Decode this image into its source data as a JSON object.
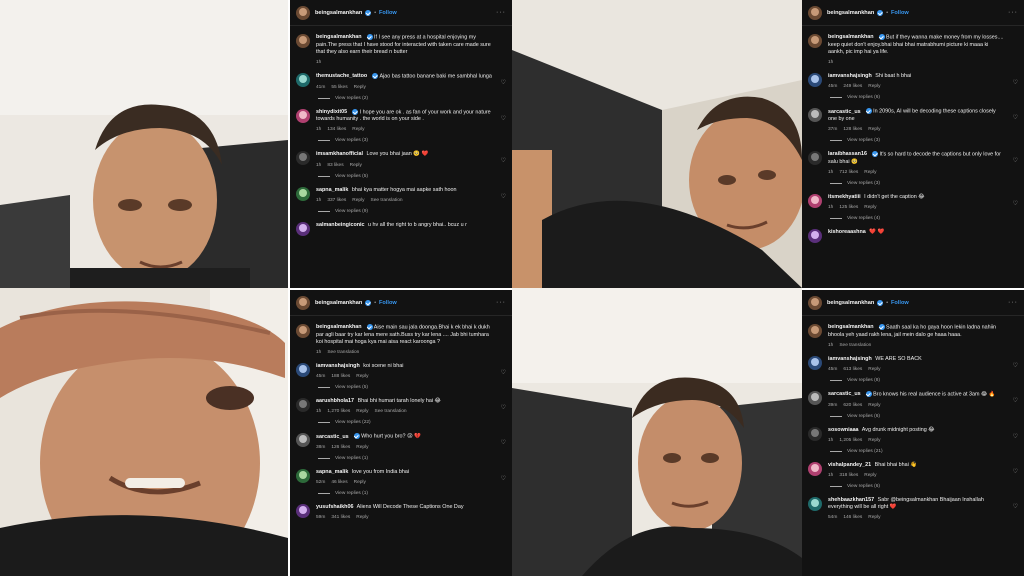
{
  "panel1": {
    "username": "beingsalmankhan",
    "follow": "Follow",
    "caption": {
      "user": "beingsalmankhan",
      "text": "If I see any press at a hospital enjoying my pain.The press that I have stood for interacted with taken care made sure that they also earn their bread n butter",
      "time": "1h"
    },
    "comments": [
      {
        "user": "themustache_tattoo",
        "text": "Ajao bas tattoo banane baki me sambhal lunga",
        "time": "41m",
        "likes": "55 likes",
        "reply": "Reply",
        "replies": "View replies (2)"
      },
      {
        "user": "shinydixit05",
        "text": "I hope you are ok . as fan of your work and your nature towards humanity . the world is on your side .",
        "time": "1h",
        "likes": "134 likes",
        "reply": "Reply",
        "replies": "View replies (3)"
      },
      {
        "user": "imsamkhanofficial",
        "text": "Love you bhai jaan 🥺 ❤️",
        "time": "1h",
        "likes": "83 likes",
        "reply": "Reply",
        "replies": "View replies (5)"
      },
      {
        "user": "sapna_malik",
        "text": "bhai kya matter hogya mai aapke sath hoon",
        "time": "1h",
        "likes": "337 likes",
        "reply": "Reply",
        "extra": "See translation",
        "replies": "View replies (9)"
      },
      {
        "user": "salmanbeingiconic",
        "text": "u hv all the right to b angry bhai.. bcuz u r",
        "time": "",
        "likes": "",
        "reply": "",
        "replies": ""
      }
    ]
  },
  "panel2": {
    "username": "beingsalmankhan",
    "follow": "Follow",
    "caption": {
      "user": "beingsalmankhan",
      "text": "But if they wanna make money from my losses.... keep quiet don't enjoy.bhai bhai bhai matrabhumi picture ki maaa ki aankh, pic imp hai ya life.",
      "time": "1h"
    },
    "comments": [
      {
        "user": "iamvanshajsingh",
        "text": "Shi baat h bhai",
        "time": "45m",
        "likes": "249 likes",
        "reply": "Reply",
        "replies": "View replies (6)"
      },
      {
        "user": "sarcastic_us",
        "text": "In 2090s, AI will be decoding these captions closely one by one",
        "time": "37m",
        "likes": "128 likes",
        "reply": "Reply",
        "replies": "View replies (3)"
      },
      {
        "user": "laraibhassan16",
        "text": "It's so hard to decode the captions but only love for salu bhai 🥺",
        "time": "1h",
        "likes": "712 likes",
        "reply": "Reply",
        "replies": "View replies (3)"
      },
      {
        "user": "itsmekhyatiii",
        "text": "I didn't get the caption 😂",
        "time": "1h",
        "likes": "125 likes",
        "reply": "Reply",
        "replies": "View replies (4)"
      },
      {
        "user": "kishoreaashna",
        "text": "❤️ ❤️",
        "time": "",
        "likes": "",
        "reply": "",
        "replies": ""
      }
    ]
  },
  "panel3": {
    "username": "beingsalmankhan",
    "follow": "Follow",
    "caption": {
      "user": "beingsalmankhan",
      "text": "Aise main sau jala doonga.Bhai k ek bhai k dukh par agli baar try kar lena mere sath.Buss try kar lena .... Jab bhi tumhara koi hospital mai hoga kya mai aisa react karoonga ?",
      "time": "1h",
      "extra": "See translation"
    },
    "comments": [
      {
        "user": "iamvanshajsingh",
        "text": "koi scene ni bhai",
        "time": "45m",
        "likes": "188 likes",
        "reply": "Reply",
        "replies": "View replies (5)"
      },
      {
        "user": "aarushbhola17",
        "text": "Bhai bhi humari tarah lonely hai 😂",
        "time": "1h",
        "likes": "1,270 likes",
        "reply": "Reply",
        "extra": "See translation",
        "replies": "View replies (22)"
      },
      {
        "user": "sarcastic_us",
        "text": "Who hurt you bro? 😢 💔",
        "time": "38m",
        "likes": "126 likes",
        "reply": "Reply",
        "replies": "View replies (1)"
      },
      {
        "user": "sapna_malik",
        "text": "love you from India bhai",
        "time": "52m",
        "likes": "46 likes",
        "reply": "Reply",
        "replies": "View replies (1)"
      },
      {
        "user": "yusufshaikh06",
        "text": "Aliens Will Decode These Captions One Day",
        "time": "59m",
        "likes": "341 likes",
        "reply": "Reply",
        "replies": ""
      }
    ]
  },
  "panel4": {
    "username": "beingsalmankhan",
    "follow": "Follow",
    "caption": {
      "user": "beingsalmankhan",
      "text": "Saath saal ka ho gaya hoon lekin ladna nahiin bhoola yeh yaad rakh lena, jail mein dalo ge haaa haaa.",
      "time": "1h",
      "extra": "See translation"
    },
    "comments": [
      {
        "user": "iamvanshajsingh",
        "text": "WE ARE SO BACK",
        "time": "45m",
        "likes": "613 likes",
        "reply": "Reply",
        "replies": "View replies (8)"
      },
      {
        "user": "sarcastic_us",
        "text": "Bro knows his real audience is active at 3am 😂 🔥",
        "time": "39m",
        "likes": "620 likes",
        "reply": "Reply",
        "replies": "View replies (6)"
      },
      {
        "user": "sosowniaaa",
        "text": "Avg drunk midnight posting 😂",
        "time": "1h",
        "likes": "1,205 likes",
        "reply": "Reply",
        "replies": "View replies (21)"
      },
      {
        "user": "vishalpandey_21",
        "text": "Bhai bhai bhai 👋",
        "time": "1h",
        "likes": "318 likes",
        "reply": "Reply",
        "replies": "View replies (6)"
      },
      {
        "user": "shehbaazkhan157",
        "text": "Sabr @beingsalmankhan Bhaijaan Inshallah everything will be all right ❤️",
        "time": "54m",
        "likes": "146 likes",
        "reply": "Reply",
        "replies": ""
      }
    ]
  }
}
